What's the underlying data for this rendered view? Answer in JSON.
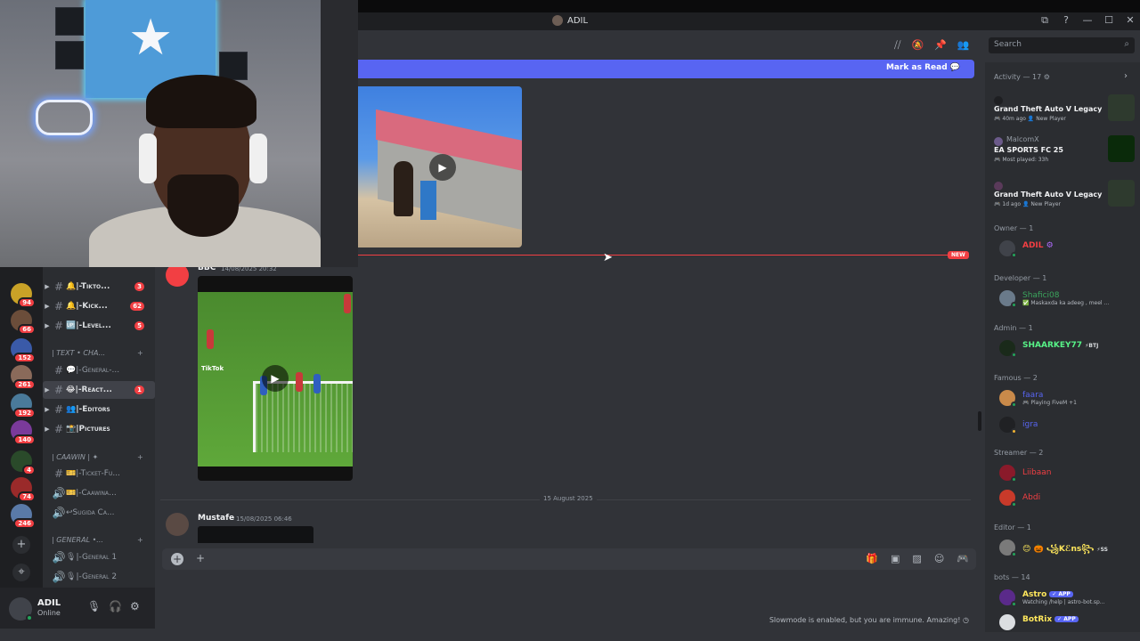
{
  "window": {
    "title": "ADIL",
    "controls": [
      "⧉",
      "?",
      "—",
      "☐",
      "✕"
    ]
  },
  "header": {
    "icons": [
      "threads-icon",
      "mute-icon",
      "pin-icon",
      "members-icon"
    ],
    "search_placeholder": "Search"
  },
  "new_messages_bar": {
    "mark_as_read": "Mark as Read"
  },
  "new_divider_label": "NEW",
  "servers": [
    {
      "badge": "94",
      "color": "#c9a227"
    },
    {
      "badge": "66",
      "color": "#6b4d3a"
    },
    {
      "badge": "152",
      "color": "#3a5aa8"
    },
    {
      "badge": "261",
      "color": "#8a6a5a"
    },
    {
      "badge": "192",
      "color": "#4a7a9a"
    },
    {
      "badge": "140",
      "color": "#7a3a9a"
    },
    {
      "badge": "4",
      "color": "#2a4a2a"
    },
    {
      "badge": "74",
      "color": "#9a2a2a"
    },
    {
      "badge": "246",
      "color": "#5a7aa8"
    }
  ],
  "channels": {
    "items": [
      {
        "label": "|-Tikto...",
        "count": "3",
        "prefix": "🔔"
      },
      {
        "label": "|-Kick...",
        "count": "62",
        "prefix": "🔔"
      },
      {
        "label": "|-Level...",
        "count": "5",
        "prefix": "🆙"
      },
      {
        "label": "|-General-...",
        "prefix": "💬"
      },
      {
        "label": "|-React...",
        "count": "1",
        "prefix": "😂"
      },
      {
        "label": "|-Editors",
        "prefix": "👥"
      },
      {
        "label": "|Pictures",
        "prefix": "📸"
      },
      {
        "label": "|-Ticket-Fu...",
        "prefix": "🎫"
      },
      {
        "label": "|-Caawina...",
        "prefix": "🎫"
      },
      {
        "label": "Sugida Ca...",
        "prefix": "↩"
      },
      {
        "label": "|-General 1",
        "prefix": "🎙"
      },
      {
        "label": "|-General 2",
        "prefix": "🎙"
      }
    ],
    "categories": [
      "| TEXT • CHA...",
      "| CAAWIN | ✦",
      "| GENERAL •..."
    ]
  },
  "user": {
    "name": "ADIL",
    "status": "Online"
  },
  "messages": [
    {
      "author": "BBC",
      "time": "14/08/2025 20:32"
    },
    {
      "author": "Mustafe",
      "time": "15/08/2025 06:46"
    }
  ],
  "video2_overlay": "TikTok",
  "date_divider": "15 August 2025",
  "composer": {
    "tools": [
      "gift-icon",
      "gif-icon",
      "sticker-icon",
      "emoji-icon",
      "apps-icon"
    ]
  },
  "slowmode_text": "Slowmode is enabled, but you are immune. Amazing!",
  "members": {
    "activity_header": "Activity — 17",
    "activities": [
      {
        "who": "",
        "game": "Grand Theft Auto V Legacy",
        "meta": "🎮 40m ago  👤 New Player",
        "icon_color": "#2e3a2e"
      },
      {
        "who": "MalcomX",
        "game": "EA SPORTS FC 25",
        "meta": "🎮 Most played: 33h",
        "icon_color": "#0a2a0a"
      },
      {
        "who": "",
        "game": "Grand Theft Auto V Legacy",
        "meta": "🎮 1d ago  👤 New Player",
        "icon_color": "#2e3a2e"
      }
    ],
    "groups": [
      {
        "title": "Owner — 1",
        "members": [
          {
            "name": "ADIL",
            "color": "#f23f43",
            "extra": "⚙"
          }
        ]
      },
      {
        "title": "Developer — 1",
        "members": [
          {
            "name": "Shafici08",
            "color": "#3ba55d",
            "sub": "✅ Maskaxda ka adeeg , meel ..."
          }
        ]
      },
      {
        "title": "Admin — 1",
        "members": [
          {
            "name": "SHAARKEY77",
            "color": "#57f287",
            "extra": "⚡BTJ"
          }
        ]
      },
      {
        "title": "Famous — 2",
        "members": [
          {
            "name": "faara",
            "color": "#5865f2",
            "sub": "🎮 Playing FiveM +1"
          },
          {
            "name": "igra",
            "color": "#5865f2"
          }
        ]
      },
      {
        "title": "Streamer — 2",
        "members": [
          {
            "name": "Liibaan",
            "color": "#f23f43"
          },
          {
            "name": "Abdi",
            "color": "#f23f43"
          }
        ]
      },
      {
        "title": "Editor — 1",
        "members": [
          {
            "name": "😊 🎃 ꧁Kℰns꧂",
            "color": "#fee75c",
            "extra": "⚡SS"
          }
        ]
      },
      {
        "title": "bots — 14",
        "members": [
          {
            "name": "Astro",
            "color": "#fee75c",
            "tag": "✓ APP",
            "sub": "Watching /help | astro-bot.sp..."
          },
          {
            "name": "BotRix",
            "color": "#fee75c",
            "tag": "✓ APP"
          }
        ]
      }
    ]
  }
}
